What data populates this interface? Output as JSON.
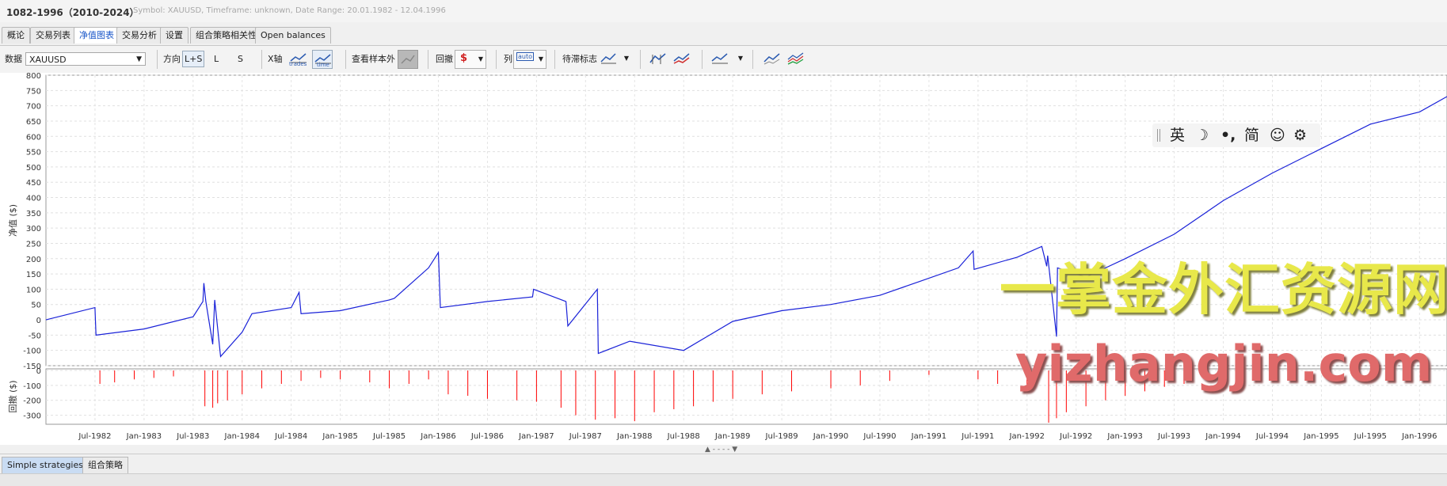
{
  "window": {
    "title": "1082-1996（2010-2024）",
    "subtitle": "Symbol: XAUUSD, Timeframe: unknown, Date Range: 20.01.1982 - 12.04.1996"
  },
  "tabs": [
    "概论",
    "交易列表",
    "净值图表",
    "交易分析",
    "设置",
    "组合策略相关性",
    "Open balances"
  ],
  "active_tab": "净值图表",
  "toolbar": {
    "data_label": "数据",
    "data_value": "XAUUSD",
    "direction_label": "方向",
    "direction_options": [
      "L+S",
      "L",
      "S"
    ],
    "xaxis_label": "X轴",
    "xaxis_trades": "trades",
    "xaxis_time": "time",
    "oos_label": "查看样本外",
    "drawdown_label": "回撤",
    "columns_label": "列",
    "columns_value": "auto",
    "benchmark_label": "待滞标志"
  },
  "chart_data": [
    {
      "type": "line",
      "ylabel": "净值 ($)",
      "ylim": [
        -150,
        800
      ],
      "yticks": [
        800,
        750,
        700,
        650,
        600,
        550,
        500,
        450,
        400,
        350,
        300,
        250,
        200,
        150,
        100,
        50,
        0,
        -50,
        -100,
        -150
      ],
      "grid": true,
      "color": "#1a22d8",
      "series": [
        {
          "x": [
            1982.0,
            1982.5,
            1982.51,
            1983.0,
            1983.5,
            1983.6,
            1983.61,
            1983.63,
            1983.7,
            1983.72,
            1983.78,
            1984.0,
            1984.1,
            1984.5,
            1984.58,
            1984.6,
            1985.0,
            1985.5,
            1985.55,
            1985.9,
            1986.0,
            1986.02,
            1986.5,
            1986.96,
            1986.97,
            1987.3,
            1987.32,
            1987.62,
            1987.63,
            1987.95,
            1988.5,
            1989.0,
            1989.5,
            1990.0,
            1990.5,
            1990.9,
            1991.3,
            1991.45,
            1991.46,
            1991.9,
            1992.15,
            1992.2,
            1992.21,
            1992.3,
            1992.31,
            1992.6,
            1993.0,
            1993.5,
            1994.0,
            1994.5,
            1995.0,
            1995.5,
            1996.0,
            1996.28
          ],
          "y": [
            0,
            40,
            -50,
            -30,
            10,
            60,
            120,
            60,
            -80,
            65,
            -120,
            -40,
            20,
            40,
            90,
            20,
            30,
            65,
            70,
            170,
            220,
            40,
            60,
            75,
            100,
            60,
            -20,
            100,
            -110,
            -70,
            -100,
            -5,
            30,
            50,
            80,
            125,
            170,
            225,
            165,
            205,
            240,
            175,
            210,
            -55,
            170,
            140,
            200,
            280,
            390,
            480,
            560,
            640,
            680,
            730
          ]
        }
      ]
    },
    {
      "type": "bar",
      "ylabel": "回撤 ($)",
      "ylim": [
        -350,
        0
      ],
      "yticks": [
        0,
        -100,
        -200,
        -300
      ],
      "color": "#ff0000",
      "note_series": "drawdown spikes",
      "series": [
        {
          "x": [
            1982.55,
            1982.7,
            1982.9,
            1983.1,
            1983.3,
            1983.62,
            1983.7,
            1983.75,
            1983.85,
            1984.0,
            1984.2,
            1984.4,
            1984.6,
            1984.8,
            1985.0,
            1985.3,
            1985.5,
            1985.7,
            1985.9,
            1986.1,
            1986.3,
            1986.5,
            1986.8,
            1987.0,
            1987.25,
            1987.4,
            1987.6,
            1987.8,
            1988.0,
            1988.2,
            1988.4,
            1988.6,
            1988.8,
            1989.0,
            1989.3,
            1989.6,
            1990.0,
            1990.3,
            1990.6,
            1991.0,
            1991.5,
            1991.7,
            1992.0,
            1992.22,
            1992.3,
            1992.4,
            1992.6,
            1992.8,
            1993.0,
            1993.2,
            1993.4,
            1993.6
          ],
          "y": [
            -90,
            -80,
            -60,
            -50,
            -40,
            -240,
            -250,
            -220,
            -200,
            -160,
            -120,
            -90,
            -70,
            -50,
            -60,
            -80,
            -120,
            -90,
            -60,
            -160,
            -170,
            -190,
            -200,
            -210,
            -250,
            -300,
            -330,
            -320,
            -340,
            -280,
            -260,
            -240,
            -210,
            -190,
            -160,
            -140,
            -120,
            -100,
            -70,
            -30,
            -60,
            -90,
            -110,
            -350,
            -320,
            -280,
            -240,
            -200,
            -170,
            -140,
            -110,
            -90
          ]
        }
      ]
    }
  ],
  "xaxis_ticks": [
    "Jul-1982",
    "Jan-1983",
    "Jul-1983",
    "Jan-1984",
    "Jul-1984",
    "Jan-1985",
    "Jul-1985",
    "Jan-1986",
    "Jul-1986",
    "Jan-1987",
    "Jul-1987",
    "Jan-1988",
    "Jul-1988",
    "Jan-1989",
    "Jul-1989",
    "Jan-1990",
    "Jul-1990",
    "Jan-1991",
    "Jul-1991",
    "Jan-1992",
    "Jul-1992",
    "Jan-1993",
    "Jul-1993",
    "Jan-1994",
    "Jul-1994",
    "Jan-1995",
    "Jul-1995",
    "Jan-1996"
  ],
  "ime": {
    "items": [
      "英",
      "☽",
      "•,",
      "简",
      "☺",
      "⚙"
    ]
  },
  "watermark": {
    "line1": "一掌金外汇资源网",
    "line2": "yizhangjin.com"
  },
  "bottom_tabs": [
    "Simple strategies",
    "组合策略"
  ],
  "active_bottom_tab": "Simple strategies"
}
